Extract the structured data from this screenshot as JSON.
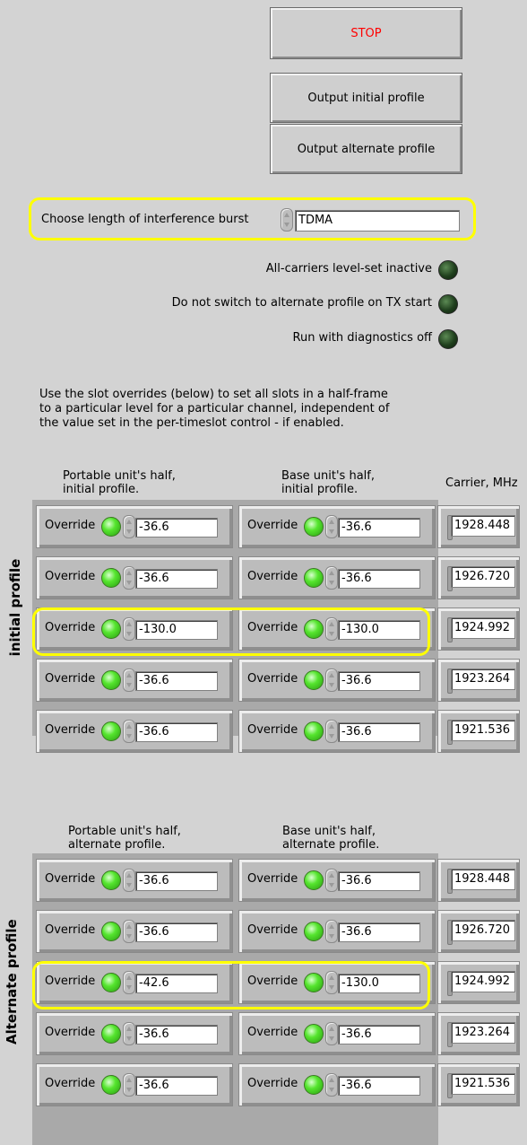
{
  "buttons": {
    "stop": "STOP",
    "output_initial": "Output initial profile",
    "output_alternate": "Output alternate profile"
  },
  "burst": {
    "label": "Choose length of interference burst",
    "value": "TDMA"
  },
  "indicators": [
    {
      "label": "All-carriers level-set inactive"
    },
    {
      "label": "Do not switch to alternate profile on TX start"
    },
    {
      "label": "Run with diagnostics off"
    }
  ],
  "description": {
    "line1": "Use the slot overrides (below) to set all slots in a half-frame",
    "line2": "to a particular level for a particular channel, independent of",
    "line3": "the value set in the per-timeslot control - if enabled."
  },
  "initial": {
    "section_label": "initial profile",
    "portable_header": {
      "line1": "Portable unit's half,",
      "line2": "initial profile."
    },
    "base_header": {
      "line1": "Base unit's half,",
      "line2": "initial profile."
    },
    "carrier_header": "Carrier, MHz",
    "override_label": "Override",
    "rows": [
      {
        "portable": "-36.6",
        "base": "-36.6",
        "carrier": "1928.448"
      },
      {
        "portable": "-36.6",
        "base": "-36.6",
        "carrier": "1926.720"
      },
      {
        "portable": "-130.0",
        "base": "-130.0",
        "carrier": "1924.992"
      },
      {
        "portable": "-36.6",
        "base": "-36.6",
        "carrier": "1923.264"
      },
      {
        "portable": "-36.6",
        "base": "-36.6",
        "carrier": "1921.536"
      }
    ]
  },
  "alternate": {
    "section_label": "Alternate profile",
    "portable_header": {
      "line1": "Portable unit's half,",
      "line2": "alternate profile."
    },
    "base_header": {
      "line1": "Base unit's half,",
      "line2": "alternate profile."
    },
    "override_label": "Override",
    "rows": [
      {
        "portable": "-36.6",
        "base": "-36.6",
        "carrier": "1928.448"
      },
      {
        "portable": "-36.6",
        "base": "-36.6",
        "carrier": "1926.720"
      },
      {
        "portable": "-42.6",
        "base": "-130.0",
        "carrier": "1924.992"
      },
      {
        "portable": "-36.6",
        "base": "-36.6",
        "carrier": "1923.264"
      },
      {
        "portable": "-36.6",
        "base": "-36.6",
        "carrier": "1921.536"
      }
    ]
  }
}
